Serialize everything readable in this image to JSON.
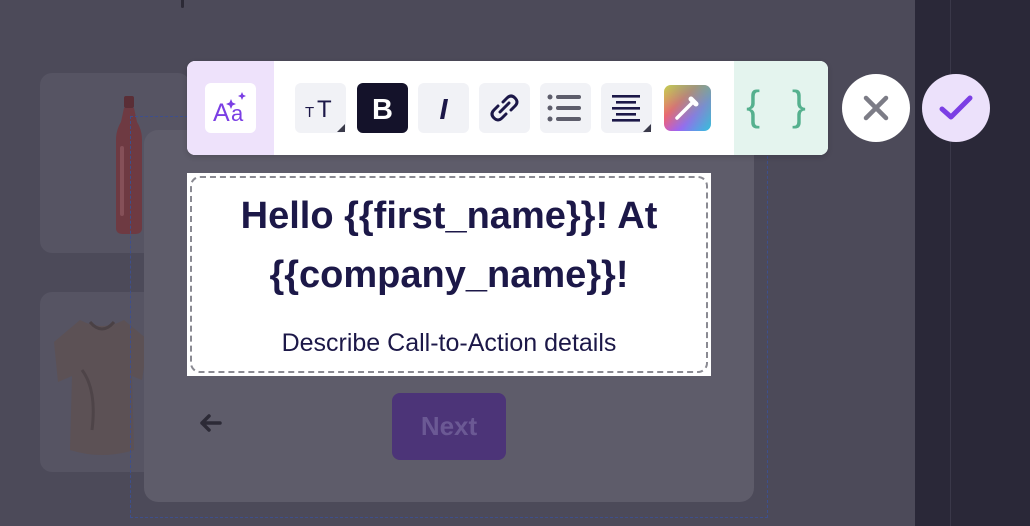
{
  "toolbar": {
    "ai_button_icon": "ai-text-sparkle-icon",
    "text_size_icon": "text-size-icon",
    "bold_label": "B",
    "italic_label": "I",
    "link_icon": "link-icon",
    "list_icon": "bullet-list-icon",
    "align_icon": "align-center-icon",
    "color_icon": "color-picker-icon",
    "variables_label": "{ }"
  },
  "actions": {
    "cancel_icon": "close-icon",
    "confirm_icon": "check-icon"
  },
  "editor": {
    "heading": "Hello {{first_name}}! At {{company_name}}!",
    "cta_text": "Describe Call-to-Action details"
  },
  "modal": {
    "back_icon": "arrow-left-icon",
    "next_label": "Next"
  },
  "colors": {
    "accent_purple": "#7b3fe4",
    "bold_bg": "#14122a",
    "text_dark": "#1c1848",
    "variables_green": "#55b08e",
    "ai_bg": "#eee2fb",
    "variables_bg": "#e4f4ee"
  }
}
